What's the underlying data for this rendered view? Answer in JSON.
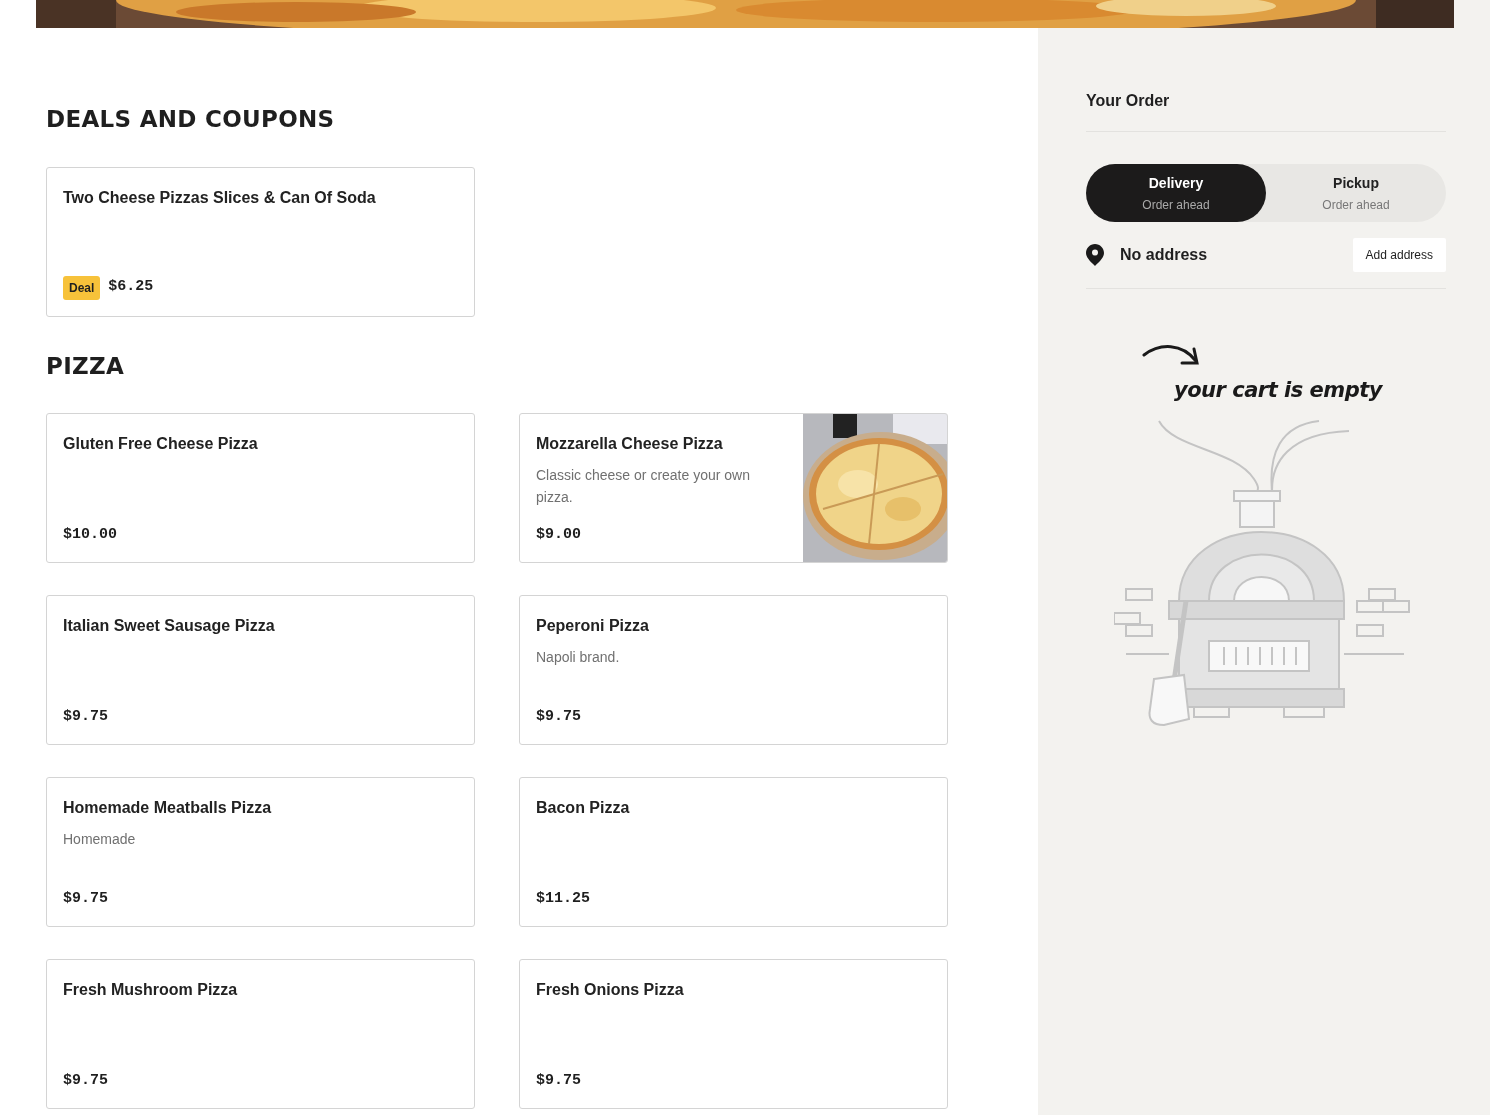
{
  "sections": [
    {
      "title": "DEALS AND COUPONS",
      "items": [
        {
          "name": "Two Cheese Pizzas Slices & Can Of Soda",
          "badge": "Deal",
          "price": "$6.25"
        }
      ]
    },
    {
      "title": "PIZZA",
      "items": [
        {
          "name": "Gluten Free Cheese Pizza",
          "price": "$10.00"
        },
        {
          "name": "Mozzarella Cheese Pizza",
          "description": "Classic cheese or create your own pizza.",
          "price": "$9.00"
        },
        {
          "name": "Italian Sweet Sausage Pizza",
          "price": "$9.75"
        },
        {
          "name": "Peperoni Pizza",
          "description": "Napoli brand.",
          "price": "$9.75"
        },
        {
          "name": "Homemade Meatballs Pizza",
          "description": "Homemade",
          "price": "$9.75"
        },
        {
          "name": "Bacon Pizza",
          "price": "$11.25"
        },
        {
          "name": "Fresh Mushroom Pizza",
          "price": "$9.75"
        },
        {
          "name": "Fresh Onions Pizza",
          "price": "$9.75"
        }
      ]
    }
  ],
  "order": {
    "title": "Your Order",
    "modes": [
      {
        "label": "Delivery",
        "sublabel": "Order ahead",
        "selected": true
      },
      {
        "label": "Pickup",
        "sublabel": "Order ahead",
        "selected": false
      }
    ],
    "address": "No address",
    "add_address": "Add address",
    "empty_message": "your cart is empty"
  }
}
